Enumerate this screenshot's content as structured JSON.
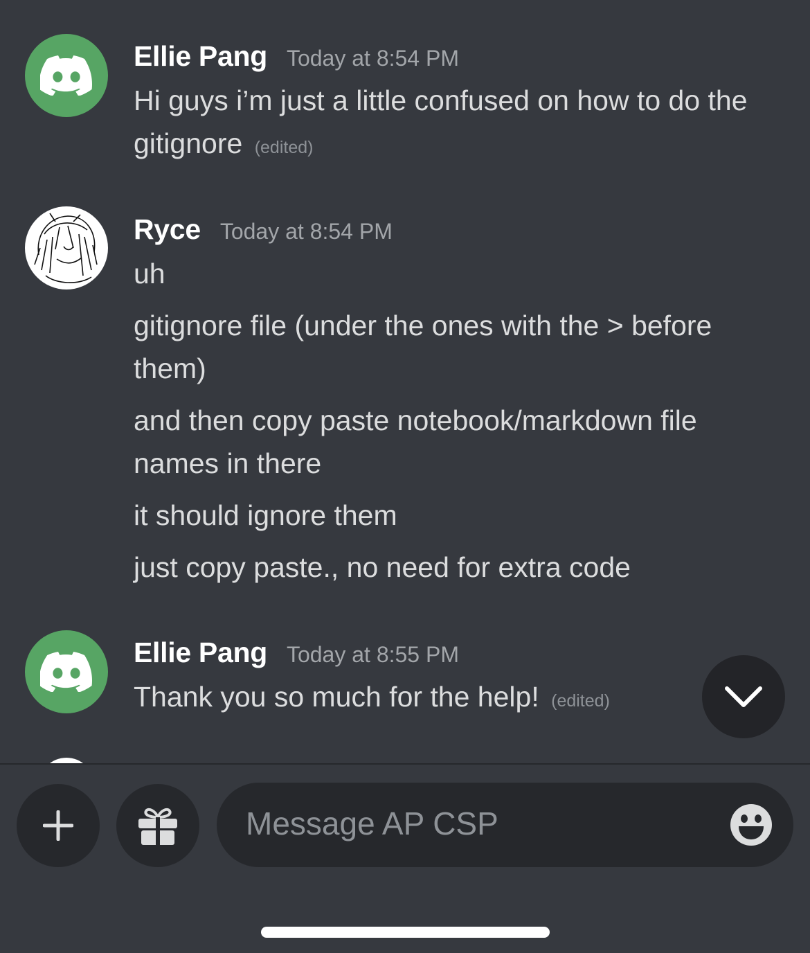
{
  "messages": [
    {
      "author": "Ellie Pang",
      "timestamp": "Today at 8:54 PM",
      "lines": [
        {
          "text": "Hi guys i’m just a little confused on how to do the gitignore",
          "edited": "(edited)"
        }
      ]
    },
    {
      "author": "Ryce",
      "timestamp": "Today at 8:54 PM",
      "lines": [
        {
          "text": "uh"
        },
        {
          "text": "gitignore file (under the ones with the > before them)"
        },
        {
          "text": "and then copy paste notebook/markdown file names in there"
        },
        {
          "text": "it should ignore them"
        },
        {
          "text": "just copy paste., no need for extra code"
        }
      ]
    },
    {
      "author": "Ellie Pang",
      "timestamp": "Today at 8:55 PM",
      "lines": [
        {
          "text": "Thank you so much for the help!",
          "edited": "(edited)"
        }
      ]
    }
  ],
  "composer": {
    "placeholder": "Message AP CSP"
  },
  "icons": {
    "add": "plus-icon",
    "gift": "gift-icon",
    "emoji": "emoji-icon",
    "scroll": "chevron-down-icon",
    "avatar_default": "discord-logo-icon"
  },
  "colors": {
    "background": "#36393f",
    "input": "#26282c",
    "avatar_green": "#57a564",
    "username": "#ffffff",
    "timestamp": "#a3a6aa"
  }
}
